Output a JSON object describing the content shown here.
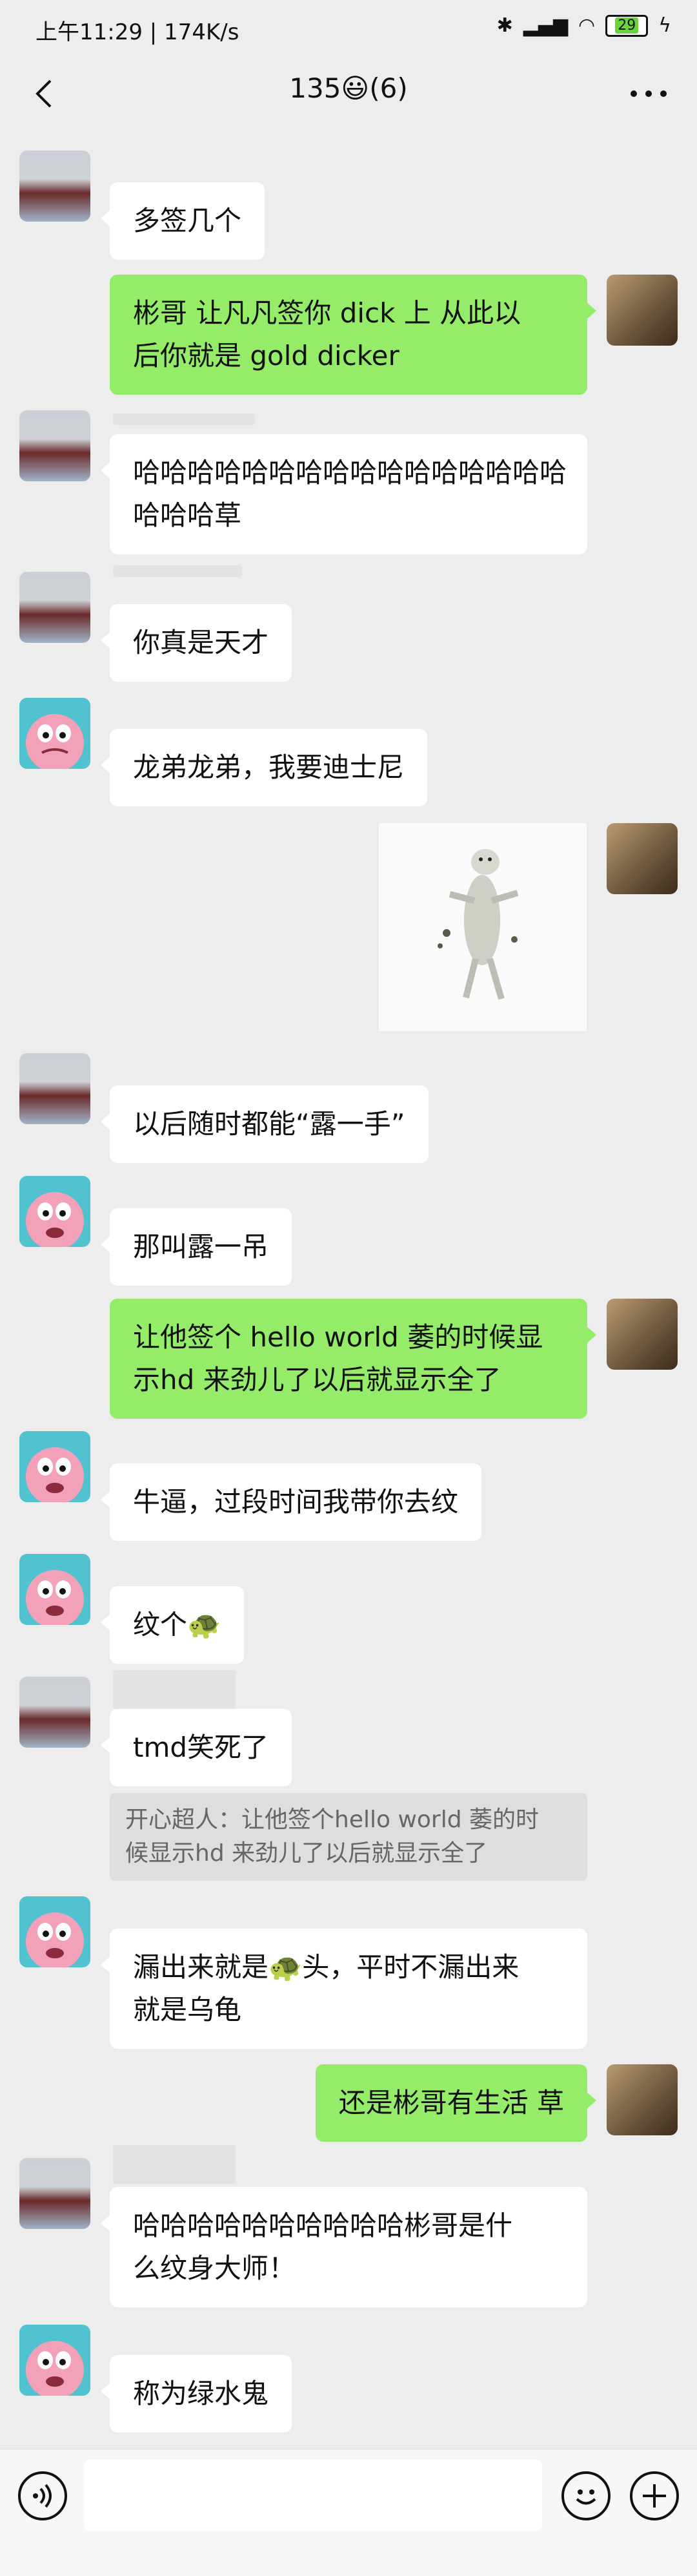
{
  "status_bar": {
    "left_text": "上午11:29 | 174K/s",
    "battery": "29"
  },
  "header": {
    "title": "135😃(6)"
  },
  "messages": [
    {
      "id": "m1",
      "text": "多签几个"
    },
    {
      "id": "m2",
      "lines": [
        "彬哥  让凡凡签你 dick 上  从此以",
        "后你就是 gold dicker"
      ]
    },
    {
      "id": "m3",
      "lines": [
        "哈哈哈哈哈哈哈哈哈哈哈哈哈哈哈哈",
        "哈哈哈草"
      ]
    },
    {
      "id": "m4",
      "text": "你真是天才"
    },
    {
      "id": "m5",
      "text": "龙弟龙弟，我要迪士尼"
    },
    {
      "id": "m6",
      "image": "sticker-dog"
    },
    {
      "id": "m7",
      "text": "以后随时都能“露一手”"
    },
    {
      "id": "m8",
      "text": "那叫露一吊"
    },
    {
      "id": "m9",
      "lines": [
        "让他签个 hello world  萎的时候显",
        "示hd  来劲儿了以后就显示全了"
      ]
    },
    {
      "id": "m10",
      "text": "牛逼，过段时间我带你去纹"
    },
    {
      "id": "m11",
      "text": "纹个🐢"
    },
    {
      "id": "m12",
      "text": "tmd笑死了",
      "quote_lines": [
        "开心超人：让他签个hello world  萎的时",
        "候显示hd  来劲儿了以后就显示全了"
      ]
    },
    {
      "id": "m13",
      "lines": [
        "漏出来就是🐢头，平时不漏出来",
        "就是乌龟"
      ]
    },
    {
      "id": "m14",
      "text": "还是彬哥有生活  草"
    },
    {
      "id": "m15",
      "lines": [
        "哈哈哈哈哈哈哈哈哈哈彬哥是什",
        "么纹身大师！"
      ]
    },
    {
      "id": "m16",
      "text": "称为绿水鬼"
    }
  ],
  "colors": {
    "background": "#ededed",
    "my_bubble": "#95ec69",
    "other_bubble": "#ffffff"
  }
}
